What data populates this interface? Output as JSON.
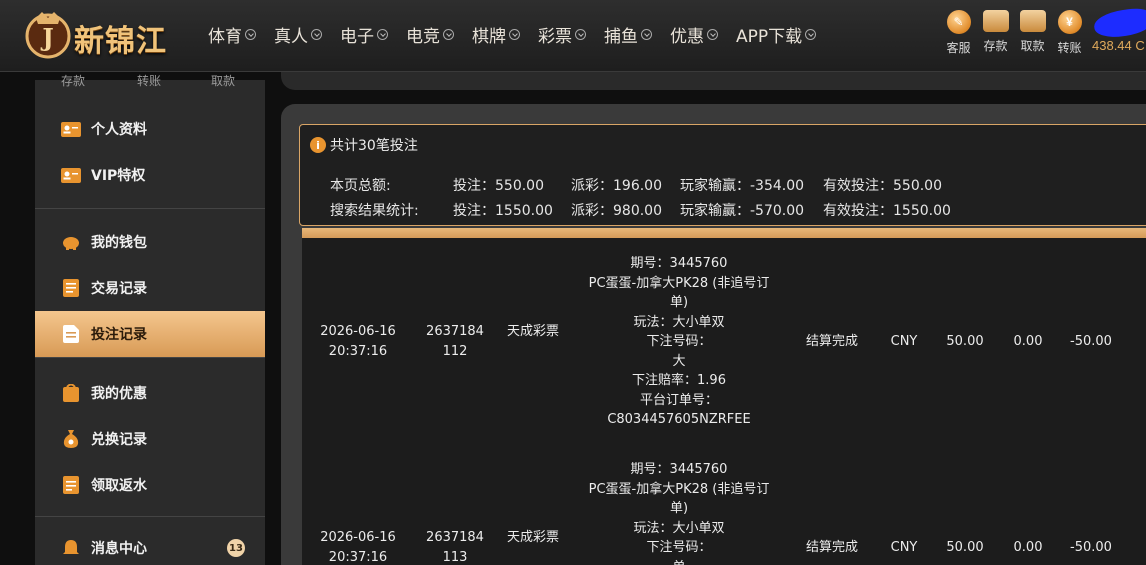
{
  "header": {
    "logo_text": "新锦江",
    "logo_letter": "J",
    "nav": [
      "体育",
      "真人",
      "电子",
      "电竞",
      "棋牌",
      "彩票",
      "捕鱼",
      "优惠",
      "APP下载"
    ],
    "tools": [
      {
        "label": "客服",
        "icon": "customer-service-icon"
      },
      {
        "label": "存款",
        "icon": "deposit-wallet-icon"
      },
      {
        "label": "取款",
        "icon": "withdraw-card-icon"
      },
      {
        "label": "转账",
        "icon": "transfer-coin-icon"
      }
    ],
    "balance": "438.44 C"
  },
  "sidebar": {
    "top_cut": [
      "存款",
      "转账",
      "取款"
    ],
    "groups": [
      [
        {
          "label": "个人资料",
          "icon": "profile-card-icon"
        },
        {
          "label": "VIP特权",
          "icon": "vip-card-icon"
        }
      ],
      [
        {
          "label": "我的钱包",
          "icon": "piggy-bank-icon"
        },
        {
          "label": "交易记录",
          "icon": "transaction-list-icon"
        },
        {
          "label": "投注记录",
          "icon": "bet-record-icon",
          "active": true
        }
      ],
      [
        {
          "label": "我的优惠",
          "icon": "promo-bag-icon"
        },
        {
          "label": "兑换记录",
          "icon": "money-bag-icon"
        },
        {
          "label": "领取返水",
          "icon": "rebate-icon"
        }
      ],
      [
        {
          "label": "消息中心",
          "icon": "bell-icon",
          "badge": "13"
        }
      ]
    ]
  },
  "summary": {
    "title": "共计30笔投注",
    "page_label": "本页总额:",
    "search_label": "搜索结果统计:",
    "page": {
      "bet": "投注：550.00",
      "payout": "派彩：196.00",
      "winloss": "玩家输赢：-354.00",
      "valid": "有效投注：550.00"
    },
    "search": {
      "bet": "投注：1550.00",
      "payout": "派彩：980.00",
      "winloss": "玩家输赢：-570.00",
      "valid": "有效投注：1550.00"
    }
  },
  "rows": [
    {
      "time": "2026-06-16 20:37:16",
      "order": "2637184 112",
      "platform": "天成彩票",
      "detail": [
        "期号：3445760",
        "PC蛋蛋-加拿大PK28 (非追号订",
        "单)",
        "玩法：大小单双",
        "下注号码：",
        "大",
        "下注赔率：1.96",
        "平台订单号：",
        "C8034457605NZRFEE"
      ],
      "status": "结算完成",
      "currency": "CNY",
      "bet": "50.00",
      "payout": "0.00",
      "winloss": "-50.00"
    },
    {
      "time": "2026-06-16 20:37:16",
      "order": "2637184 113",
      "platform": "天成彩票",
      "detail": [
        "期号：3445760",
        "PC蛋蛋-加拿大PK28 (非追号订",
        "单)",
        "玩法：大小单双",
        "下注号码：",
        "单"
      ],
      "status": "结算完成",
      "currency": "CNY",
      "bet": "50.00",
      "payout": "0.00",
      "winloss": "-50.00"
    }
  ],
  "colors": {
    "accent": "#e8942f",
    "active_bg": "#f4c68e",
    "panel": "#3a3a3a"
  }
}
